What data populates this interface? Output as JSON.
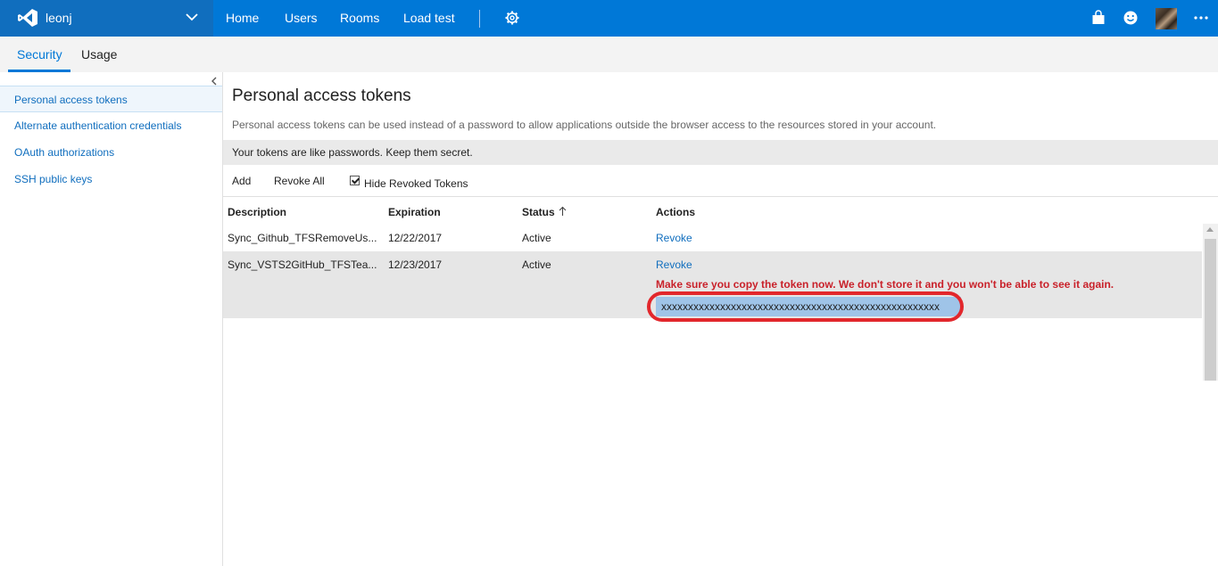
{
  "topbar": {
    "account_name": "leonj",
    "nav": [
      "Home",
      "Users",
      "Rooms",
      "Load test"
    ],
    "icons": [
      "settings-gear-icon",
      "shopping-bag-icon",
      "smiley-feedback-icon",
      "user-avatar",
      "more-ellipsis-icon"
    ],
    "colors": {
      "bar": "#0078d7",
      "account": "#106ebe"
    }
  },
  "tabs": {
    "active": "Security",
    "other": "Usage"
  },
  "sidebar": {
    "items": [
      {
        "label": "Personal access tokens",
        "selected": true
      },
      {
        "label": "Alternate authentication credentials",
        "selected": false
      },
      {
        "label": "OAuth authorizations",
        "selected": false
      },
      {
        "label": "SSH public keys",
        "selected": false
      }
    ]
  },
  "main": {
    "title": "Personal access tokens",
    "description": "Personal access tokens can be used instead of a password to allow applications outside the browser access to the resources stored in your account.",
    "warning": "Your tokens are like passwords. Keep them secret.",
    "toolbar": {
      "add": "Add",
      "revoke_all": "Revoke All",
      "hide_revoked": "Hide Revoked Tokens",
      "hide_revoked_checked": true
    },
    "table": {
      "headers": {
        "description": "Description",
        "expiration": "Expiration",
        "status": "Status",
        "actions": "Actions"
      },
      "sort": "status ascending",
      "rows": [
        {
          "description": "Sync_Github_TFSRemoveUs...",
          "expiration": "12/22/2017",
          "status": "Active",
          "action": "Revoke"
        },
        {
          "description": "Sync_VSTS2GitHub_TFSTea...",
          "expiration": "12/23/2017",
          "status": "Active",
          "action": "Revoke"
        }
      ]
    },
    "copy_warning": "Make sure you copy the token now. We don't store it and you won't be able to see it again.",
    "token_value": "xxxxxxxxxxxxxxxxxxxxxxxxxxxxxxxxxxxxxxxxxxxxxxxxxxxx",
    "highlight_color": "#e2272c"
  }
}
